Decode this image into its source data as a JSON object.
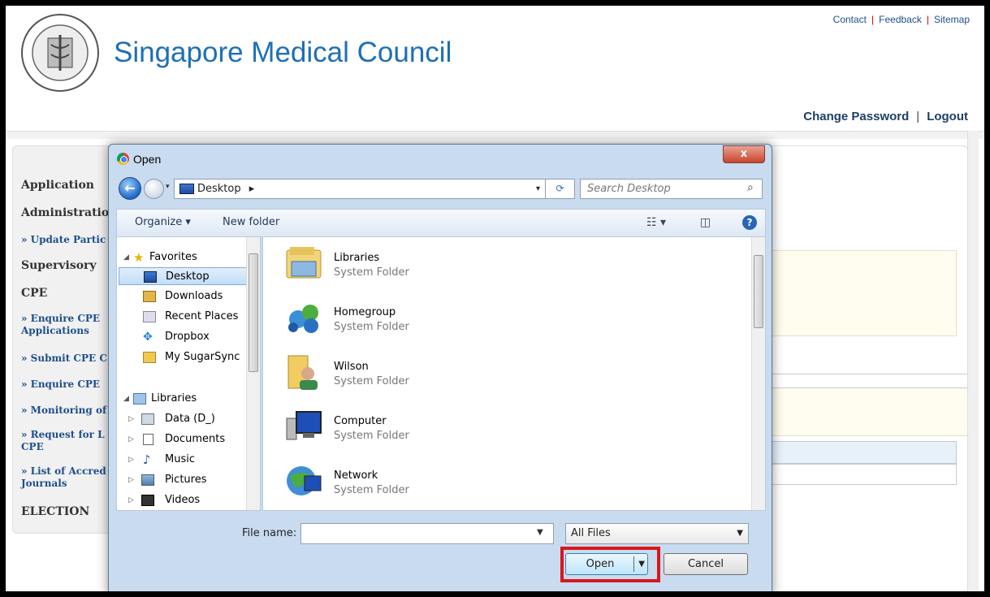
{
  "site": {
    "title": "Singapore Medical Council",
    "logo_text": "SINGAPORE MEDICAL COUNCIL",
    "top_links": [
      "Contact",
      "Feedback",
      "Sitemap"
    ],
    "user_links": [
      "Change Password",
      "Logout"
    ]
  },
  "left_nav": [
    {
      "label": "Application",
      "type": "header"
    },
    {
      "label": "Administratio",
      "type": "header"
    },
    {
      "label": "» Update Partic",
      "type": "sub"
    },
    {
      "label": "Supervisory",
      "type": "header"
    },
    {
      "label": "CPE",
      "type": "header"
    },
    {
      "label": "» Enquire CPE Applications",
      "type": "sub"
    },
    {
      "label": "» Submit CPE C",
      "type": "sub"
    },
    {
      "label": "» Enquire CPE",
      "type": "sub"
    },
    {
      "label": "» Monitoring of",
      "type": "sub"
    },
    {
      "label": "» Request for L CPE",
      "type": "sub"
    },
    {
      "label": "» List of Accred Journals",
      "type": "sub"
    },
    {
      "label": "ELECTION",
      "type": "header"
    }
  ],
  "dialog": {
    "title": "Open",
    "close_label": "x",
    "address": "Desktop",
    "address_chevron": "▸",
    "search_placeholder": "Search Desktop",
    "toolbar": {
      "organize": "Organize ▾",
      "new_folder": "New folder",
      "help": "?"
    },
    "nav_tree": [
      {
        "label": "Favorites",
        "icon": "star-icon",
        "expanded": true
      },
      {
        "label": "Desktop",
        "icon": "desktop-icon",
        "selected": true
      },
      {
        "label": "Downloads",
        "icon": "downloads-icon"
      },
      {
        "label": "Recent Places",
        "icon": "recent-places-icon"
      },
      {
        "label": "Dropbox",
        "icon": "dropbox-icon"
      },
      {
        "label": "My SugarSync",
        "icon": "folder-icon"
      },
      {
        "label": "Libraries",
        "icon": "libraries-icon",
        "expanded": true
      },
      {
        "label": "Data (D_)",
        "icon": "drive-icon"
      },
      {
        "label": "Documents",
        "icon": "documents-icon"
      },
      {
        "label": "Music",
        "icon": "music-icon"
      },
      {
        "label": "Pictures",
        "icon": "pictures-icon"
      },
      {
        "label": "Videos",
        "icon": "videos-icon"
      }
    ],
    "files": [
      {
        "name": "Libraries",
        "type": "System Folder",
        "icon": "libraries-folder-icon"
      },
      {
        "name": "Homegroup",
        "type": "System Folder",
        "icon": "homegroup-icon"
      },
      {
        "name": "Wilson",
        "type": "System Folder",
        "icon": "user-folder-icon"
      },
      {
        "name": "Computer",
        "type": "System Folder",
        "icon": "computer-icon"
      },
      {
        "name": "Network",
        "type": "System Folder",
        "icon": "network-icon"
      }
    ],
    "file_name_label": "File name:",
    "file_name_value": "",
    "file_type": "All Files",
    "open_label": "Open",
    "cancel_label": "Cancel"
  },
  "colors": {
    "title_blue": "#1e6fb8",
    "highlight_red": "#d9161b",
    "dialog_frame": "#c9dbef"
  }
}
